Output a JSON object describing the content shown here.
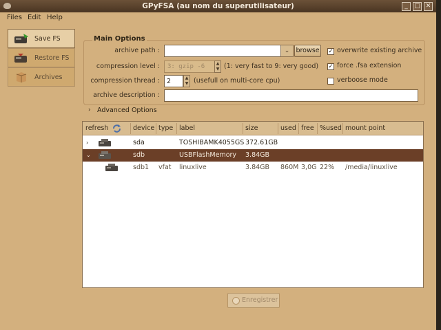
{
  "window": {
    "title": "GPyFSA (au nom du superutilisateur)",
    "controls": [
      "_",
      "□",
      "✕"
    ]
  },
  "menubar": {
    "items": [
      "Files",
      "Edit",
      "Help"
    ]
  },
  "sidebar": {
    "items": [
      {
        "label": "Save FS",
        "icon": "save-disk-icon",
        "active": true
      },
      {
        "label": "Restore FS",
        "icon": "restore-disk-icon",
        "active": false
      },
      {
        "label": "Archives",
        "icon": "archive-box-icon",
        "active": false
      }
    ]
  },
  "main_options": {
    "title": "Main Options",
    "archive_path": {
      "label": "archive path :",
      "value": "",
      "browse_label": "browse"
    },
    "compression_level": {
      "label": "compression level :",
      "value": "3: gzip  -6",
      "hint": "(1: very fast to 9: very good)"
    },
    "compression_thread": {
      "label": "compression thread :",
      "value": "2",
      "hint": "(usefull on multi-core cpu)"
    },
    "archive_description": {
      "label": "archive description :",
      "value": ""
    },
    "checkboxes": [
      {
        "label": "overwrite existing archive",
        "checked": true
      },
      {
        "label": "force .fsa extension",
        "checked": true
      },
      {
        "label": "verboose mode",
        "checked": false
      }
    ]
  },
  "advanced_options": {
    "label": "Advanced Options"
  },
  "devices": {
    "columns": [
      "refresh",
      "device",
      "type",
      "label",
      "size",
      "used",
      "free",
      "%used",
      "mount point"
    ],
    "rows": [
      {
        "expander": "›",
        "device": "sda",
        "type": "",
        "label": "TOSHIBAMK4055GS",
        "size": "372.61GB",
        "used": "",
        "free": "",
        "pct": "",
        "mount": "",
        "selected": false
      },
      {
        "expander": "⌄",
        "device": "sdb",
        "type": "",
        "label": "USBFlashMemory",
        "size": "3.84GB",
        "used": "",
        "free": "",
        "pct": "",
        "mount": "",
        "selected": true
      },
      {
        "expander": "",
        "device": "sdb1",
        "type": "vfat",
        "label": "linuxlive",
        "size": "3.84GB",
        "used": "860M",
        "free": "3,0G",
        "pct": "22%",
        "mount": "/media/linuxlive",
        "selected": false
      }
    ]
  },
  "footer": {
    "save_button": "Enregistrer"
  },
  "colors": {
    "selected_row": "#6b3f27",
    "window_bg": "#d3b07e",
    "accent": "#e7cfa6"
  }
}
